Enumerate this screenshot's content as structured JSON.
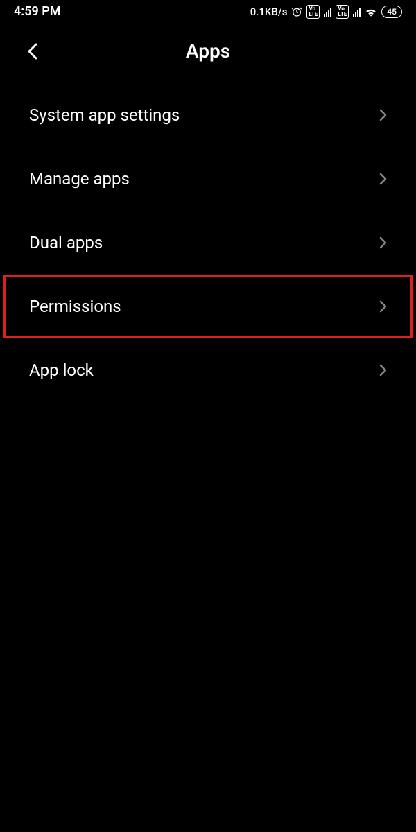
{
  "status_bar": {
    "time": "4:59 PM",
    "network_speed": "0.1KB/s",
    "battery": "45"
  },
  "header": {
    "title": "Apps"
  },
  "menu": {
    "items": [
      {
        "label": "System app settings",
        "highlighted": false
      },
      {
        "label": "Manage apps",
        "highlighted": false
      },
      {
        "label": "Dual apps",
        "highlighted": false
      },
      {
        "label": "Permissions",
        "highlighted": true
      },
      {
        "label": "App lock",
        "highlighted": false
      }
    ]
  }
}
